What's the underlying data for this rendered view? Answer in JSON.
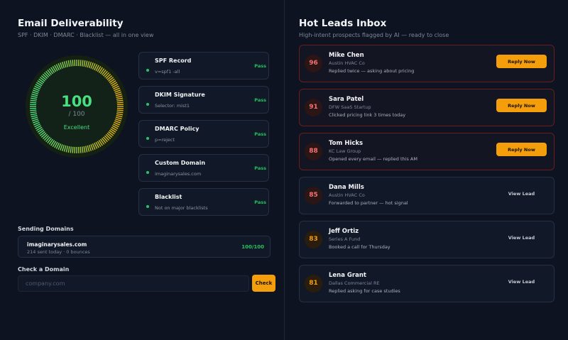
{
  "deliverability": {
    "title": "Email Deliverability",
    "subtitle": "SPF · DKIM · DMARC · Blacklist — all in one view",
    "gauge": {
      "score": "100",
      "max": "/ 100",
      "status": "Excellent",
      "fraction": 1.0
    },
    "checks": [
      {
        "title": "SPF Record",
        "detail": "v=spf1 -all",
        "status": "Pass"
      },
      {
        "title": "DKIM Signature",
        "detail": "Selector: mist1",
        "status": "Pass"
      },
      {
        "title": "DMARC Policy",
        "detail": "p=reject",
        "status": "Pass"
      },
      {
        "title": "Custom Domain",
        "detail": "imaginarysales.com",
        "status": "Pass"
      },
      {
        "title": "Blacklist",
        "detail": "Not on major blacklists",
        "status": "Pass"
      }
    ],
    "sending_domains": {
      "label": "Sending Domains",
      "domain": "imaginarysales.com",
      "stats": "214 sent today · 0 bounces",
      "score": "100/100"
    },
    "check_domain": {
      "label": "Check a Domain",
      "placeholder": "company.com",
      "button": "Check"
    }
  },
  "inbox": {
    "title": "Hot Leads Inbox",
    "subtitle": "High-intent prospects flagged by AI — ready to close",
    "leads": [
      {
        "score": "96",
        "name": "Mike Chen",
        "company": "Austin HVAC Co",
        "note": "Replied twice — asking about pricing",
        "action": "Reply Now"
      },
      {
        "score": "91",
        "name": "Sara Patel",
        "company": "DFW SaaS Startup",
        "note": "Clicked pricing link 3 times today",
        "action": "Reply Now"
      },
      {
        "score": "88",
        "name": "Tom Hicks",
        "company": "KC Law Group",
        "note": "Opened every email — replied this AM",
        "action": "Reply Now"
      },
      {
        "score": "85",
        "name": "Dana Mills",
        "company": "Austin HVAC Co",
        "note": "Forwarded to partner — hot signal",
        "action": "View Lead"
      },
      {
        "score": "83",
        "name": "Jeff Ortiz",
        "company": "Series A Fund",
        "note": "Booked a call for Thursday",
        "action": "View Lead"
      },
      {
        "score": "81",
        "name": "Lena Grant",
        "company": "Dallas Commercial RE",
        "note": "Replied asking for case studies",
        "action": "View Lead"
      }
    ]
  },
  "colors": {
    "accent": "#f59e0b",
    "pass": "#22c55e",
    "score_green": "#4ade80",
    "hot_red": "#f87171",
    "background": "#0d1320"
  }
}
